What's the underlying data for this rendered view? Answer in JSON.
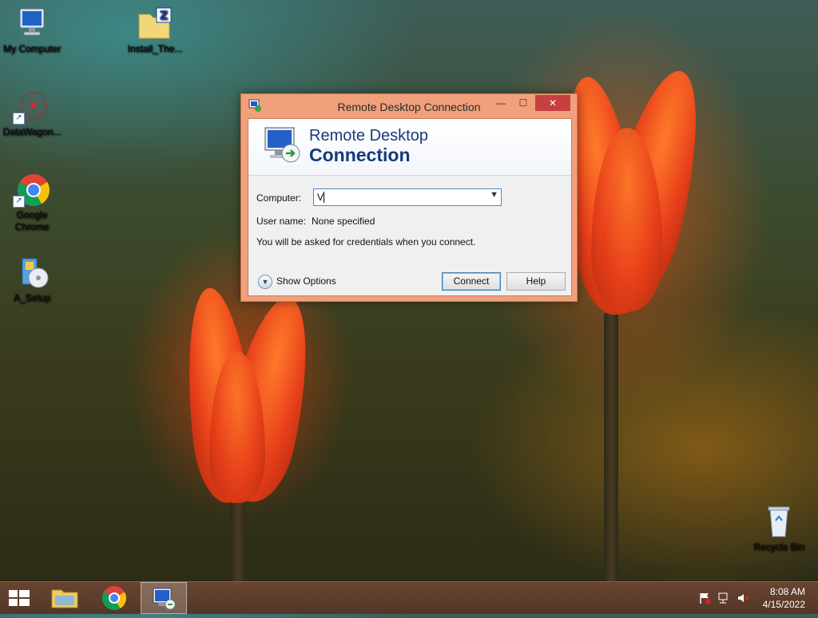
{
  "desktop": {
    "icons": [
      {
        "label": "My Computer",
        "icon": "computer-icon"
      },
      {
        "label": "Install_The...",
        "icon": "zip-folder-icon"
      },
      {
        "label": "DataWagon...",
        "icon": "datawagon-icon"
      },
      {
        "label": "Google Chrome",
        "icon": "chrome-icon"
      },
      {
        "label": "A_Setup",
        "icon": "setup-icon"
      },
      {
        "label": "Recycle Bin",
        "icon": "recycle-bin-icon"
      }
    ]
  },
  "window": {
    "title": "Remote Desktop Connection",
    "banner_line1": "Remote Desktop",
    "banner_line2": "Connection",
    "computer_label": "Computer:",
    "computer_value": "V",
    "username_label": "User name:",
    "username_value": "None specified",
    "note": "You will be asked for credentials when you connect.",
    "show_options_label": "Show Options",
    "connect_label": "Connect",
    "help_label": "Help"
  },
  "taskbar": {
    "time": "8:08 AM",
    "date": "4/15/2022"
  },
  "colors": {
    "window_frame": "#f0a07a",
    "close_button": "#c74040",
    "banner_text": "#143a7c"
  }
}
